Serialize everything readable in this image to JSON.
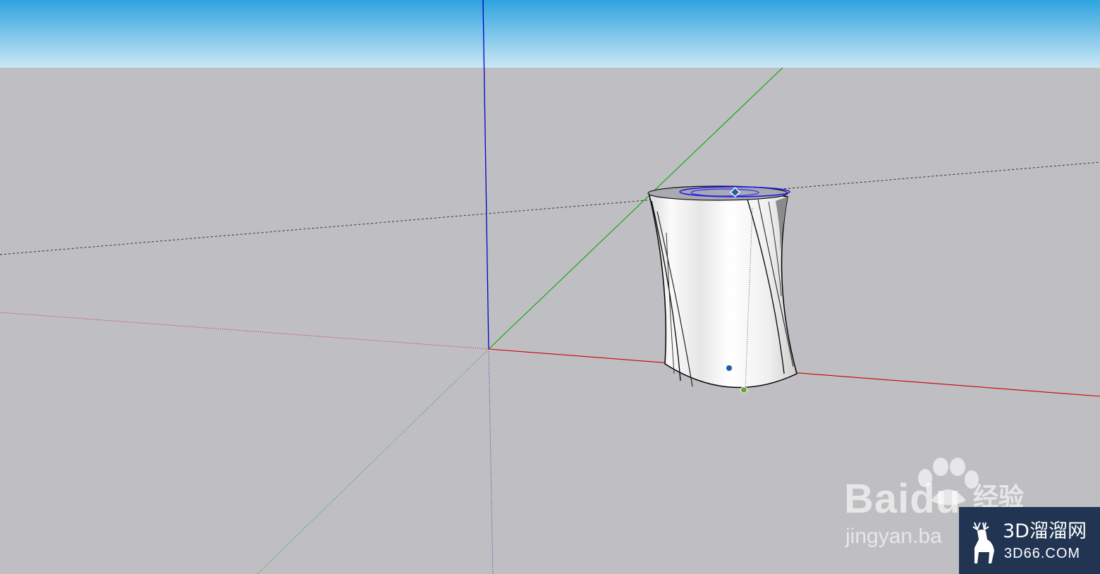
{
  "scene": {
    "sky_color_top": "#2ea3df",
    "sky_color_bottom": "#c9e6f4",
    "ground_color": "#bfbfc3",
    "axis_colors": {
      "red": "#cc0000",
      "green": "#00aa00",
      "blue": "#0000cc"
    },
    "model": "twisted-cylinder"
  },
  "watermarks": {
    "baidu": {
      "brand": "Baidu",
      "brand_cn": "经验",
      "url": "jingyan.ba"
    },
    "site_3d66": {
      "title": "3D溜溜网",
      "url": "3D66.COM",
      "bg_color": "#213552"
    }
  }
}
